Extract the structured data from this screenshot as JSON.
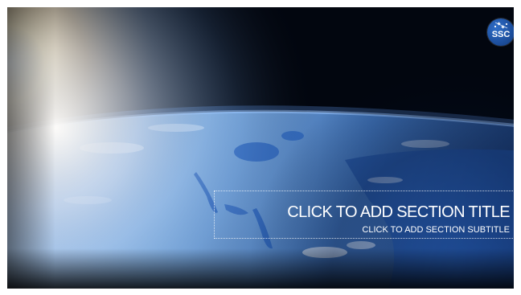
{
  "slide": {
    "section_title_placeholder": "CLICK TO ADD SECTION TITLE",
    "section_subtitle_placeholder": "CLICK TO ADD SECTION SUBTITLE"
  },
  "logo": {
    "text": "SSC",
    "color": "#1d4f9e"
  },
  "colors": {
    "space": "#02060f",
    "sunlight": "#f4b54a",
    "ocean": "#1d4f9e",
    "land": "#6f9ccc"
  }
}
